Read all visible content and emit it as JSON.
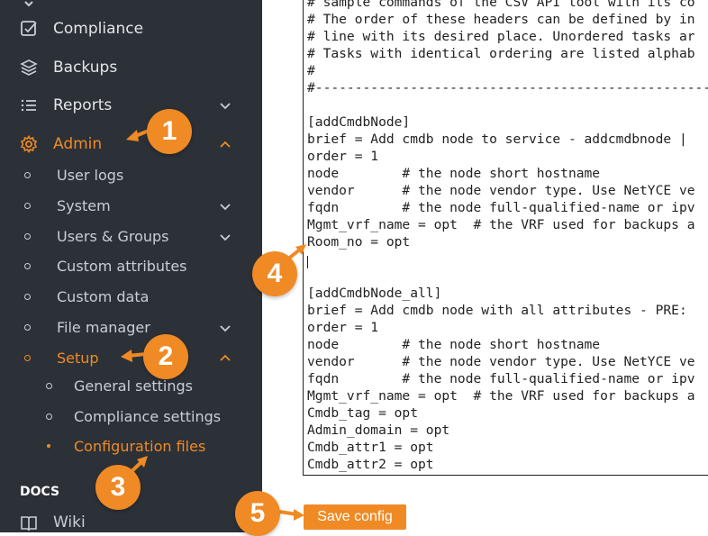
{
  "sidebar": {
    "nav": [
      {
        "label": "Compliance",
        "icon": "compliance-icon"
      },
      {
        "label": "Backups",
        "icon": "layers-icon"
      },
      {
        "label": "Reports",
        "icon": "list-icon"
      },
      {
        "label": "Admin",
        "icon": "gear-icon"
      }
    ],
    "admin_items": [
      {
        "label": "User logs"
      },
      {
        "label": "System"
      },
      {
        "label": "Users & Groups"
      },
      {
        "label": "Custom attributes"
      },
      {
        "label": "Custom data"
      },
      {
        "label": "File manager"
      },
      {
        "label": "Setup"
      }
    ],
    "setup_items": [
      {
        "label": "General settings"
      },
      {
        "label": "Compliance settings"
      },
      {
        "label": "Configuration files"
      }
    ],
    "docs_heading": "DOCS",
    "wiki_label": "Wiki"
  },
  "editor": {
    "lines": [
      "# sample commands of the CSV API tool with its co",
      "# The order of these headers can be defined by in",
      "# line with its desired place. Unordered tasks ar",
      "# Tasks with identical ordering are listed alphab",
      "#",
      "#-----------------------------------------------------",
      "",
      "[addCmdbNode]",
      "brief = Add cmdb node to service - addcmdbnode |",
      "order = 1",
      "node        # the node short hostname",
      "vendor      # the node vendor type. Use NetYCE ve",
      "fqdn        # the node full-qualified-name or ipv",
      "Mgmt_vrf_name = opt  # the VRF used for backups a",
      "Room_no = opt",
      "",
      "",
      "[addCmdbNode_all]",
      "brief = Add cmdb node with all attributes - PRE:",
      "order = 1",
      "node        # the node short hostname",
      "vendor      # the node vendor type. Use NetYCE ve",
      "fqdn        # the node full-qualified-name or ipv",
      "Mgmt_vrf_name = opt  # the VRF used for backups a",
      "Cmdb_tag = opt",
      "Admin_domain = opt",
      "Cmdb_attr1 = opt",
      "Cmdb_attr2 = opt"
    ]
  },
  "save_button": "Save config",
  "markers": [
    "1",
    "2",
    "3",
    "4",
    "5"
  ],
  "colors": {
    "accent": "#f08a24",
    "sidebar_bg": "#2c3138"
  }
}
